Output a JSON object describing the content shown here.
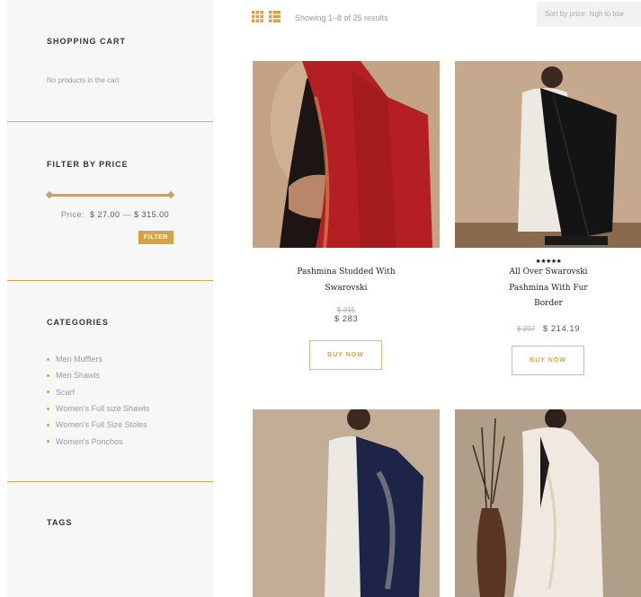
{
  "sidebar": {
    "cart": {
      "title": "SHOPPING CART",
      "empty_text": "No products in the cart."
    },
    "price_filter": {
      "title": "FILTER BY PRICE",
      "price_label": "Price:",
      "min": "$ 27.00",
      "sep": "—",
      "max": "$ 315.00",
      "button": "FILTER"
    },
    "categories": {
      "title": "CATEGORIES",
      "items": [
        "Men Mufflers",
        "Men Shawls",
        "Scarf",
        "Women's Full size Shawls",
        "Women's Full Size Stoles",
        "Women's Ponchos"
      ]
    },
    "tags": {
      "title": "TAGS"
    }
  },
  "toolbar": {
    "result_count": "Showing 1–8 of 25 results",
    "sort": "Sort by price: high to low"
  },
  "products": [
    {
      "title_l1": "Pashmina Studded With",
      "title_l2": "Swarovski",
      "old_price": "$ 315",
      "price": "$ 283",
      "button": "BUY NOW"
    },
    {
      "rating": "★★★★★",
      "title_l1": "All Over Swarovski",
      "title_l2": "Pashmina With Fur",
      "title_l3": "Border",
      "old_price": "$ 297",
      "price": "$ 214.19",
      "button": "BUY NOW"
    },
    {},
    {}
  ],
  "colors": {
    "accent": "#d4a24a",
    "divider": "#d4a55a",
    "sidebar_bg": "#f7f7f7"
  }
}
